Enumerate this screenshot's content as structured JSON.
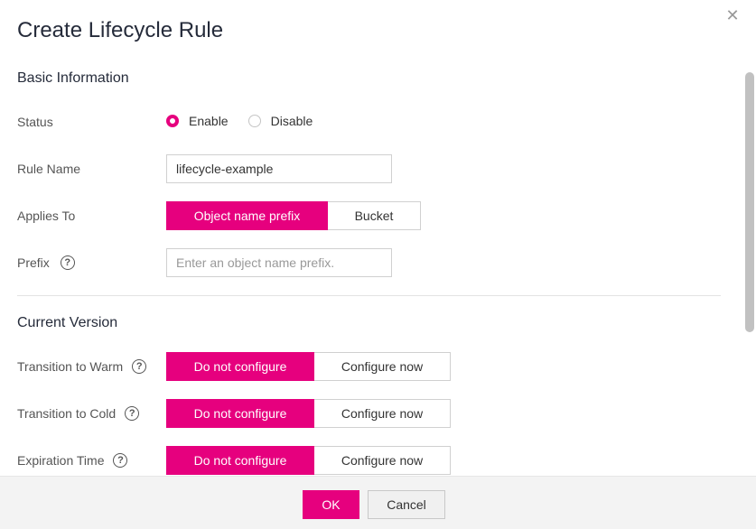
{
  "dialog": {
    "title": "Create Lifecycle Rule",
    "close_icon": "close-icon"
  },
  "basic": {
    "section_title": "Basic Information",
    "status": {
      "label": "Status",
      "options": [
        "Enable",
        "Disable"
      ],
      "selected": "Enable"
    },
    "rule_name": {
      "label": "Rule Name",
      "value": "lifecycle-example"
    },
    "applies_to": {
      "label": "Applies To",
      "options": [
        "Object name prefix",
        "Bucket"
      ],
      "selected": "Object name prefix"
    },
    "prefix": {
      "label": "Prefix",
      "placeholder": "Enter an object name prefix.",
      "help_icon": "question-circle-icon"
    }
  },
  "current_version": {
    "section_title": "Current Version",
    "transition_warm": {
      "label": "Transition to Warm",
      "options": [
        "Do not configure",
        "Configure now"
      ],
      "selected": "Do not configure"
    },
    "transition_cold": {
      "label": "Transition to Cold",
      "options": [
        "Do not configure",
        "Configure now"
      ],
      "selected": "Do not configure"
    },
    "expiration": {
      "label": "Expiration Time",
      "options": [
        "Do not configure",
        "Configure now"
      ],
      "selected": "Do not configure"
    }
  },
  "footer": {
    "ok_label": "OK",
    "cancel_label": "Cancel"
  },
  "colors": {
    "accent": "#e6007e",
    "footer_bg": "#f3f3f3"
  }
}
